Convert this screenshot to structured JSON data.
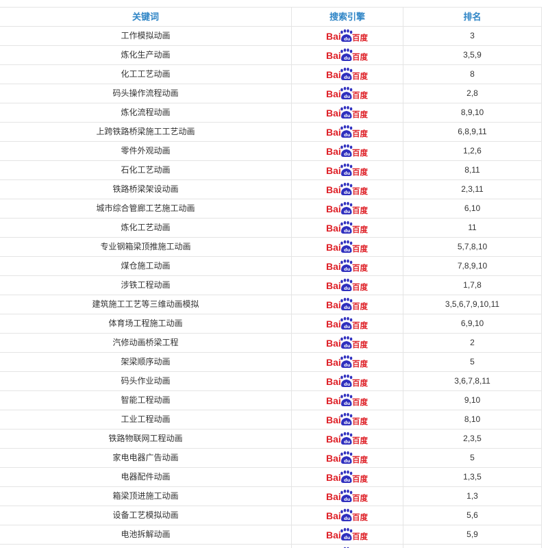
{
  "table": {
    "headers": {
      "keyword": "关键词",
      "engine": "搜索引擎",
      "rank": "排名"
    },
    "engine_logo": {
      "icon": "baidu-logo-icon",
      "brand_text_left": "Bai",
      "brand_text_right": "百度",
      "colors": {
        "red": "#de1f26",
        "blue": "#2f2fbe"
      }
    },
    "header_color": "#2f85c6",
    "rows": [
      {
        "keyword": "工作模拟动画",
        "rank": "3"
      },
      {
        "keyword": "炼化生产动画",
        "rank": "3,5,9"
      },
      {
        "keyword": "化工工艺动画",
        "rank": "8"
      },
      {
        "keyword": "码头操作流程动画",
        "rank": "2,8"
      },
      {
        "keyword": "炼化流程动画",
        "rank": "8,9,10"
      },
      {
        "keyword": "上跨铁路桥梁施工工艺动画",
        "rank": "6,8,9,11"
      },
      {
        "keyword": "零件外观动画",
        "rank": "1,2,6"
      },
      {
        "keyword": "石化工艺动画",
        "rank": "8,11"
      },
      {
        "keyword": "铁路桥梁架设动画",
        "rank": "2,3,11"
      },
      {
        "keyword": "城市综合管廊工艺施工动画",
        "rank": "6,10"
      },
      {
        "keyword": "炼化工艺动画",
        "rank": "11"
      },
      {
        "keyword": "专业钢箱梁顶推施工动画",
        "rank": "5,7,8,10"
      },
      {
        "keyword": "煤仓施工动画",
        "rank": "7,8,9,10"
      },
      {
        "keyword": "涉铁工程动画",
        "rank": "1,7,8"
      },
      {
        "keyword": "建筑施工工艺等三维动画模拟",
        "rank": "3,5,6,7,9,10,11"
      },
      {
        "keyword": "体育场工程施工动画",
        "rank": "6,9,10"
      },
      {
        "keyword": "汽修动画桥梁工程",
        "rank": "2"
      },
      {
        "keyword": "架梁顺序动画",
        "rank": "5"
      },
      {
        "keyword": "码头作业动画",
        "rank": "3,6,7,8,11"
      },
      {
        "keyword": "智能工程动画",
        "rank": "9,10"
      },
      {
        "keyword": "工业工程动画",
        "rank": "8,10"
      },
      {
        "keyword": "铁路物联网工程动画",
        "rank": "2,3,5"
      },
      {
        "keyword": "家电电器广告动画",
        "rank": "5"
      },
      {
        "keyword": "电器配件动画",
        "rank": "1,3,5"
      },
      {
        "keyword": "箱梁顶进施工动画",
        "rank": "1,3"
      },
      {
        "keyword": "设备工艺模拟动画",
        "rank": "5,6"
      },
      {
        "keyword": "电池拆解动画",
        "rank": "5,9"
      },
      {
        "keyword": "",
        "rank": ""
      }
    ]
  }
}
